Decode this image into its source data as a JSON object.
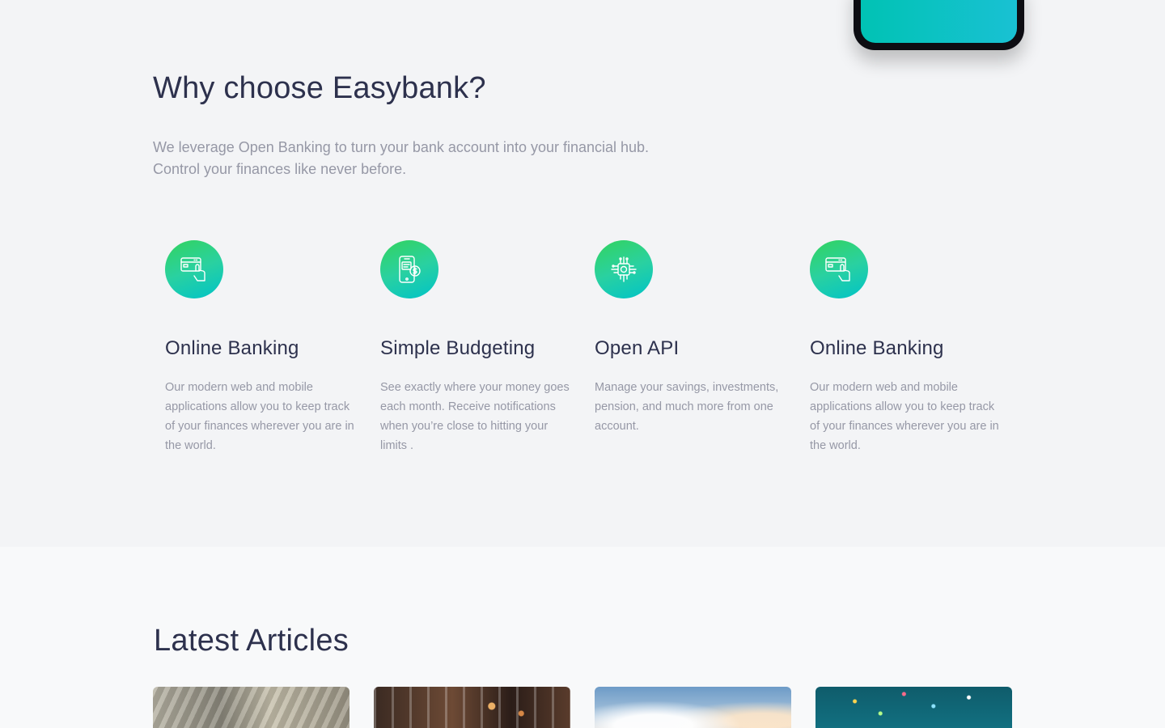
{
  "why": {
    "title": "Why choose Easybank?",
    "description_lines": [
      "We leverage Open Banking to turn your bank account into your financial hub.",
      "Control your finances like never before."
    ],
    "features": [
      {
        "icon": "card-hand-icon",
        "title": "Online Banking",
        "text": "Our modern web and mobile applications allow you to keep track of your finances wherever you are in the world."
      },
      {
        "icon": "phone-budget-icon",
        "title": "Simple Budgeting",
        "text": "See exactly where your money goes each month. Receive notifications when you’re close to hitting your limits ."
      },
      {
        "icon": "chip-api-icon",
        "title": "Open API",
        "text": "Manage your savings, investments, pension, and much more from one account."
      },
      {
        "icon": "card-hand-icon",
        "title": "Online Banking",
        "text": "Our modern web and mobile applications allow you to keep track of your finances wherever you are in the world."
      }
    ]
  },
  "articles": {
    "title": "Latest Articles",
    "cards": [
      {
        "image": "money-photo"
      },
      {
        "image": "restaurant-photo"
      },
      {
        "image": "sky-photo"
      },
      {
        "image": "confetti-photo"
      }
    ]
  },
  "colors": {
    "accent_green": "#33d35e",
    "accent_cyan": "#00c3c8",
    "heading": "#2d314d",
    "body_text": "#9698a6"
  }
}
